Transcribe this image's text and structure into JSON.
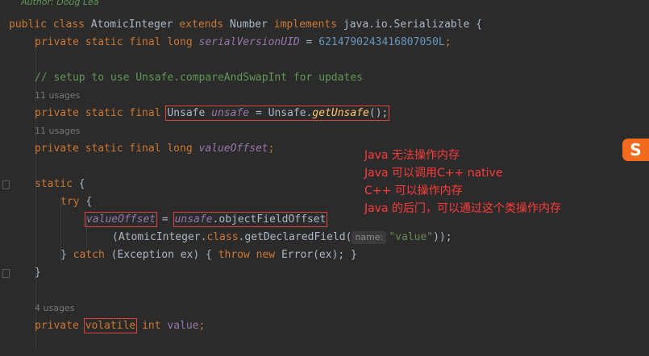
{
  "header_comment": "Author: Doug Lea",
  "code": {
    "class_decl": {
      "kw_public": "public",
      "kw_class": "class",
      "name": "AtomicInteger",
      "kw_extends": "extends",
      "super": "Number",
      "kw_implements": "implements",
      "iface": "java.io.Serializable",
      "brace": "{"
    },
    "serial": {
      "mods": "private static final long",
      "name": "serialVersionUID",
      "eq": " = ",
      "value": "6214790243416807050L",
      "semi": ";"
    },
    "comment": "// setup to use Unsafe.compareAndSwapInt for updates",
    "usages_1": "11 usages",
    "unsafe_decl": {
      "mods": "private static final",
      "type": "Unsafe",
      "name": "unsafe",
      "eq": " = Unsafe.",
      "method": "getUnsafe",
      "end": "();"
    },
    "usages_2": "11 usages",
    "value_offset_decl": {
      "mods": "private static final long",
      "name": "valueOffset",
      "semi": ";"
    },
    "static_block": "static",
    "brace_open": "{",
    "try_kw": "try",
    "assign": {
      "target": "valueOffset",
      "eq": "=",
      "obj": "unsafe",
      "call": ".objectFieldOffset"
    },
    "field_call": {
      "open": "(AtomicInteger.",
      "kw_class": "class",
      "method": ".getDeclaredField(",
      "hint": "name:",
      "arg": "\"value\"",
      "close": "));"
    },
    "catch_line": {
      "close": "} ",
      "kw_catch": "catch",
      "params": " (Exception ex) { ",
      "kw_throw": "throw",
      "kw_new": "new",
      "rest": " Error(ex); }"
    },
    "brace_close": "}",
    "usages_3": "4 usages",
    "value_decl": {
      "kw_private": "private",
      "kw_volatile": "volatile",
      "kw_int": "int",
      "name": "value",
      "semi": ";"
    }
  },
  "annotation": [
    "Java 无法操作内存",
    "Java 可以调用C++ native",
    "C++ 可以操作内存",
    "Java 的后门，可以通过这个类操作内存"
  ],
  "logo_text": "S"
}
